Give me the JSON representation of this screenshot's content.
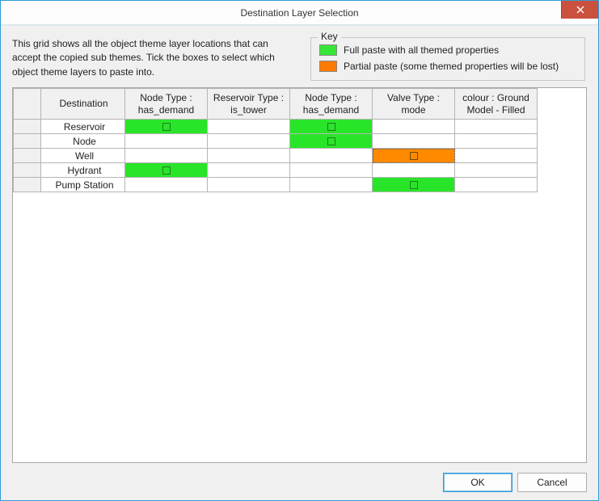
{
  "window": {
    "title": "Destination Layer Selection"
  },
  "description": "This grid shows all the object theme layer locations that can accept the copied sub themes. Tick the boxes to select which object theme layers to paste into.",
  "key": {
    "label": "Key",
    "items": [
      {
        "swatch": "green",
        "text": "Full paste with all themed properties"
      },
      {
        "swatch": "orange",
        "text": "Partial paste (some themed properties will be lost)"
      }
    ]
  },
  "grid": {
    "columns": [
      "Destination",
      "Node Type : has_demand",
      "Reservoir Type : is_tower",
      "Node Type : has_demand",
      "Valve Type : mode",
      "colour : Ground Model - Filled"
    ],
    "rows": [
      {
        "dest": "Reservoir",
        "cells": [
          "green",
          "",
          "green",
          "",
          ""
        ]
      },
      {
        "dest": "Node",
        "cells": [
          "",
          "",
          "green",
          "",
          ""
        ]
      },
      {
        "dest": "Well",
        "cells": [
          "",
          "",
          "",
          "orange",
          ""
        ]
      },
      {
        "dest": "Hydrant",
        "cells": [
          "green",
          "",
          "",
          "",
          ""
        ]
      },
      {
        "dest": "Pump Station",
        "cells": [
          "",
          "",
          "",
          "green",
          ""
        ]
      }
    ],
    "focused": {
      "row": 2,
      "col": 3
    }
  },
  "buttons": {
    "ok": "OK",
    "cancel": "Cancel"
  },
  "colors": {
    "green": "#29e529",
    "orange": "#ff8a00",
    "accent": "#2e9cd7",
    "close": "#c9513e"
  }
}
